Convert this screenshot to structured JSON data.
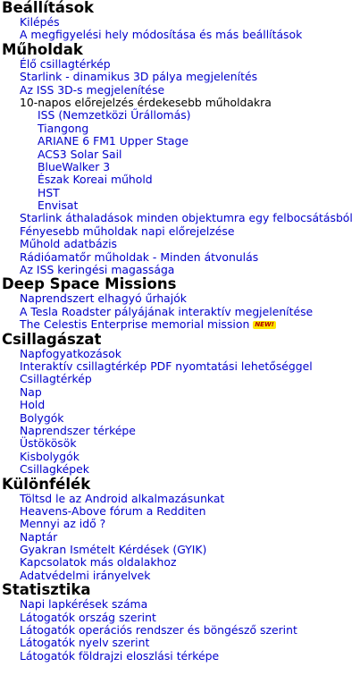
{
  "sections": [
    {
      "title": "Beállítások",
      "items": [
        {
          "label": "Kilépés"
        },
        {
          "label": "A megfigyelési hely módosítása és más beállítások"
        }
      ]
    },
    {
      "title": "Műholdak",
      "items": [
        {
          "label": "Élő csillagtérkép"
        },
        {
          "label": "Starlink - dinamikus 3D pálya megjelenítés"
        },
        {
          "label": "Az ISS 3D-s megjelenítése"
        },
        {
          "label": "10-napos előrejelzés érdekesebb műholdakra"
        },
        {
          "label": "ISS (Nemzetközi Űrállomás)"
        },
        {
          "label": "Tiangong"
        },
        {
          "label": "ARIANE 6 FM1 Upper Stage"
        },
        {
          "label": "ACS3 Solar Sail"
        },
        {
          "label": "BlueWalker 3"
        },
        {
          "label": "Észak Koreai műhold"
        },
        {
          "label": "HST"
        },
        {
          "label": "Envisat"
        },
        {
          "label": "Starlink áthaladások minden objektumra egy felbocsátásból"
        },
        {
          "label": "Fényesebb műholdak napi előrejelzése"
        },
        {
          "label": "Műhold adatbázis"
        },
        {
          "label": "Rádióamatőr műholdak - Minden átvonulás"
        },
        {
          "label": "Az ISS keringési magassága"
        }
      ]
    },
    {
      "title": "Deep Space Missions",
      "items": [
        {
          "label": "Naprendszert elhagyó űrhajók"
        },
        {
          "label": "A Tesla Roadster pályájának interaktív megjelenítése"
        },
        {
          "label": "The Celestis Enterprise memorial mission",
          "badge": "NEW!"
        }
      ]
    },
    {
      "title": "Csillagászat",
      "items": [
        {
          "label": "Napfogyatkozások"
        },
        {
          "label": "Interaktív csillagtérkép PDF nyomtatási lehetőséggel"
        },
        {
          "label": "Csillagtérkép"
        },
        {
          "label": "Nap"
        },
        {
          "label": "Hold"
        },
        {
          "label": "Bolygók"
        },
        {
          "label": "Naprendszer térképe"
        },
        {
          "label": "Üstökösök"
        },
        {
          "label": "Kisbolygók"
        },
        {
          "label": "Csillagképek"
        }
      ]
    },
    {
      "title": "Különfélék",
      "items": [
        {
          "label": "Töltsd le az Android alkalmazásunkat"
        },
        {
          "label": "Heavens-Above fórum a Redditen"
        },
        {
          "label": "Mennyi az idő ?"
        },
        {
          "label": "Naptár"
        },
        {
          "label": "Gyakran Ismételt Kérdések (GYIK)"
        },
        {
          "label": "Kapcsolatok más oldalakhoz"
        },
        {
          "label": "Adatvédelmi irányelvek"
        }
      ]
    },
    {
      "title": "Statisztika",
      "items": [
        {
          "label": "Napi lapkérések száma"
        },
        {
          "label": "Látogatók ország szerint"
        },
        {
          "label": "Látogatók operációs rendszer és böngésző szerint"
        },
        {
          "label": "Látogatók nyelv szerint"
        },
        {
          "label": "Látogatók földrajzi eloszlási térképe"
        }
      ]
    }
  ],
  "colors": {
    "link": "#0000cc",
    "heading": "#000000",
    "plain": "#000000",
    "badge_bg": "#ffe600",
    "badge_text": "#b00000"
  }
}
